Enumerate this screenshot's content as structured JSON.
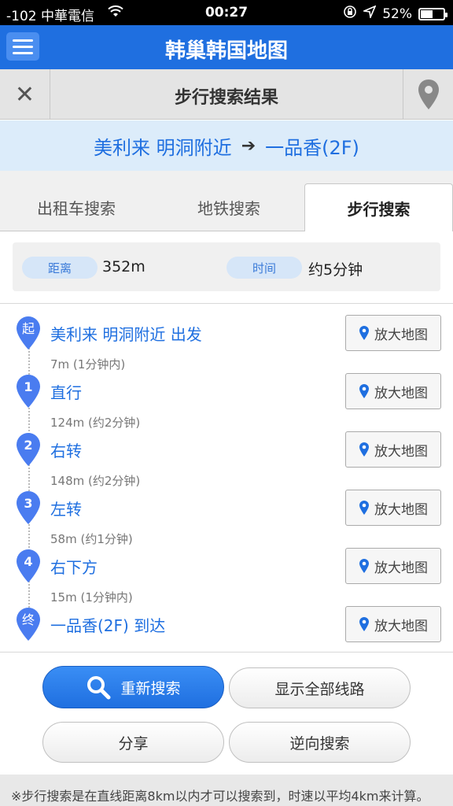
{
  "status_bar": {
    "carrier": "-102 中華電信",
    "time": "00:27",
    "battery": "52%",
    "battery_level": 0.52
  },
  "header": {
    "title": "韩巢韩国地图"
  },
  "sub_header": {
    "title": "步行搜索结果",
    "close_glyph": "✕"
  },
  "route": {
    "from": "美利来 明洞附近",
    "arrow": "➔",
    "to": "一品香(2F)"
  },
  "tabs": [
    {
      "label": "出租车搜索",
      "active": false
    },
    {
      "label": "地铁搜索",
      "active": false
    },
    {
      "label": "步行搜索",
      "active": true
    }
  ],
  "summary": {
    "distance_label": "距离",
    "distance_value": "352m",
    "time_label": "时间",
    "time_value": "约5分钟"
  },
  "steps": [
    {
      "marker": "起",
      "label": "美利来 明洞附近 出发",
      "distance": "7m (1分钟内)",
      "button": "放大地图"
    },
    {
      "marker": "1",
      "label": "直行",
      "distance": "124m (约2分钟)",
      "button": "放大地图"
    },
    {
      "marker": "2",
      "label": "右转",
      "distance": "148m (约2分钟)",
      "button": "放大地图"
    },
    {
      "marker": "3",
      "label": "左转",
      "distance": "58m (约1分钟)",
      "button": "放大地图"
    },
    {
      "marker": "4",
      "label": "右下方",
      "distance": "15m (1分钟内)",
      "button": "放大地图"
    },
    {
      "marker": "终",
      "label": "一品香(2F) 到达",
      "distance": "",
      "button": "放大地图"
    }
  ],
  "actions": {
    "research": "重新搜索",
    "show_all": "显示全部线路",
    "share": "分享",
    "reverse": "逆向搜索"
  },
  "footnote": "※步行搜索是在直线距离8km以内才可以搜索到，时速以平均4km来计算。",
  "colors": {
    "primary": "#1f6fe0",
    "marker": "#4a7cf0",
    "banner": "#dcecfa"
  }
}
